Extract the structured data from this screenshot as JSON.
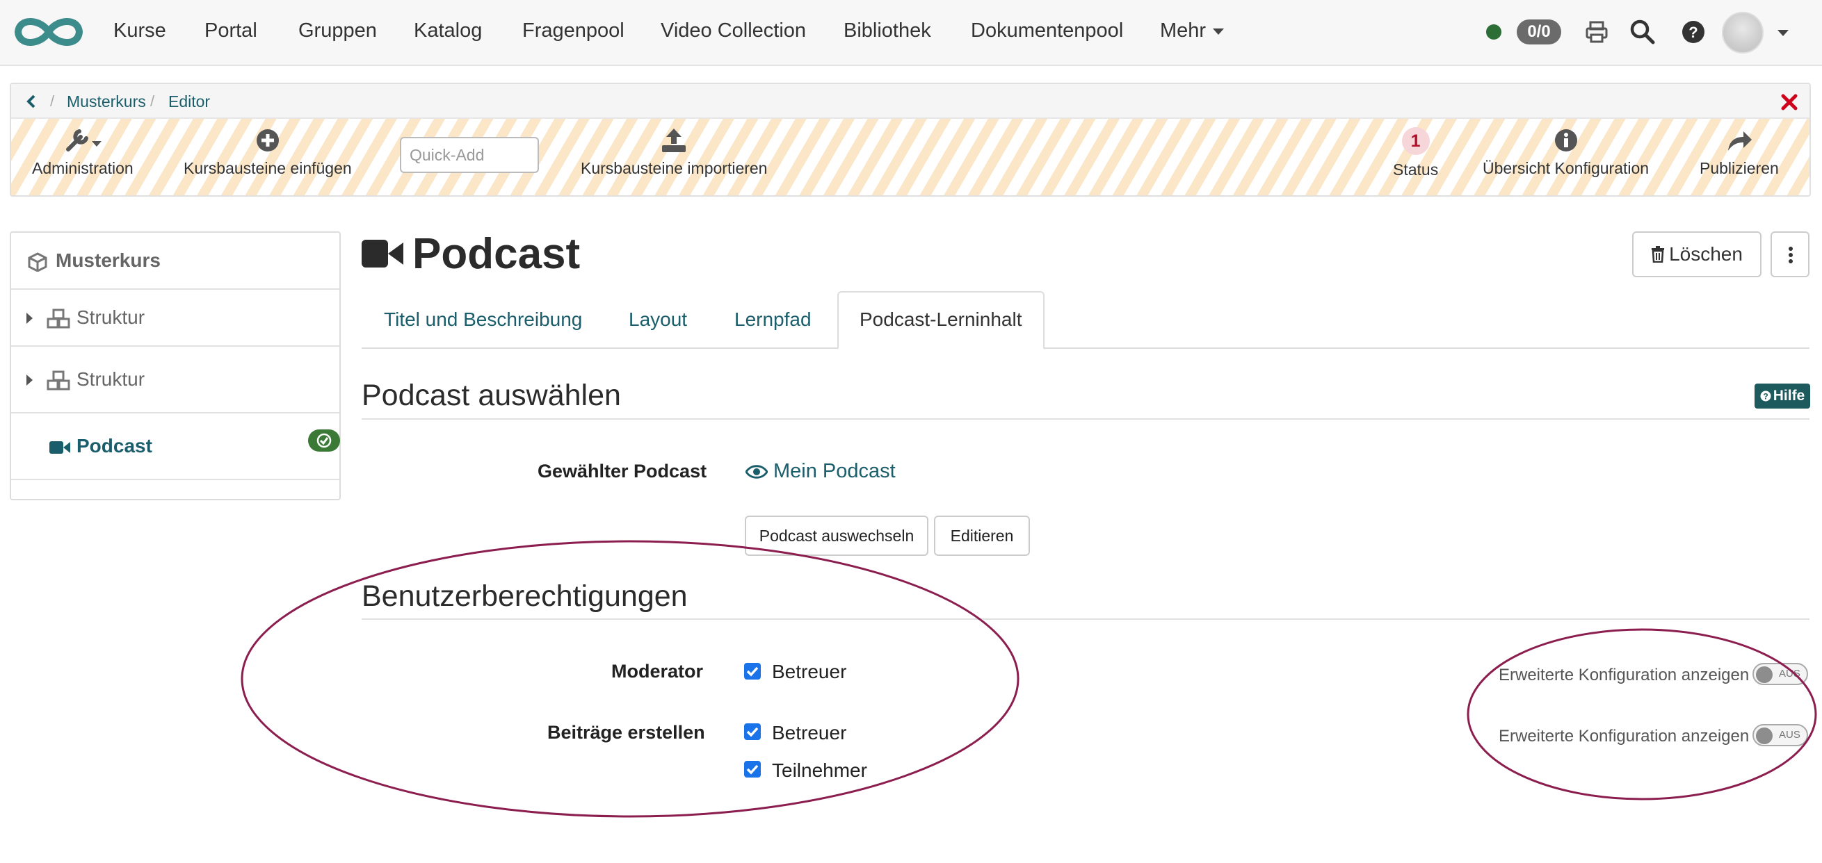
{
  "topnav": {
    "items": [
      "Kurse",
      "Portal",
      "Gruppen",
      "Katalog",
      "Fragenpool",
      "Video Collection",
      "Bibliothek",
      "Dokumentenpool",
      "Mehr"
    ],
    "counter": "0/0"
  },
  "breadcrumb": {
    "items": [
      "Musterkurs",
      "Editor"
    ]
  },
  "toolbar": {
    "administration": "Administration",
    "insert": "Kursbausteine einfügen",
    "quick_add_placeholder": "Quick-Add",
    "import": "Kursbausteine importieren",
    "status_count": "1",
    "status": "Status",
    "overview": "Übersicht Konfiguration",
    "publish": "Publizieren"
  },
  "sidebar": {
    "course": "Musterkurs",
    "items": [
      {
        "label": "Struktur"
      },
      {
        "label": "Struktur"
      },
      {
        "label": "Podcast"
      }
    ]
  },
  "page": {
    "title": "Podcast",
    "delete": "Löschen",
    "tabs": [
      "Titel und Beschreibung",
      "Layout",
      "Lernpfad",
      "Podcast-Lerninhalt"
    ]
  },
  "select_section": {
    "title": "Podcast auswählen",
    "help": "Hilfe",
    "selected_label": "Gewählter Podcast",
    "selected_value": "Mein Podcast",
    "change_button": "Podcast auswechseln",
    "edit_button": "Editieren"
  },
  "permissions": {
    "title": "Benutzerberechtigungen",
    "moderator_label": "Moderator",
    "moderator_options": [
      "Betreuer"
    ],
    "create_label": "Beiträge erstellen",
    "create_options": [
      "Betreuer",
      "Teilnehmer"
    ],
    "advanced_text": "Erweiterte Konfiguration anzeigen",
    "toggle_state": "AUS"
  },
  "colors": {
    "accent": "#1b5e6b",
    "annotation": "#8c1e4f",
    "toolbar_stripe": "#fbe7c8",
    "check": "#1a73e8"
  }
}
